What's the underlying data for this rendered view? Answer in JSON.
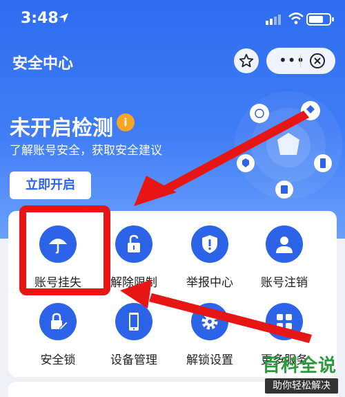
{
  "status_bar": {
    "time": "3:48"
  },
  "nav": {
    "title": "安全中心"
  },
  "detection": {
    "title": "未开启检测",
    "info_badge": "i",
    "subtitle": "了解账号安全，获取安全建议",
    "button_label": "立即开启"
  },
  "grid": [
    {
      "label": "账号挂失",
      "icon": "umbrella-icon"
    },
    {
      "label": "解除限制",
      "icon": "unlock-icon"
    },
    {
      "label": "举报中心",
      "icon": "shield-alert-icon"
    },
    {
      "label": "账号注销",
      "icon": "person-icon"
    },
    {
      "label": "安全锁",
      "icon": "lock-edit-icon"
    },
    {
      "label": "设备管理",
      "icon": "phone-icon"
    },
    {
      "label": "解锁设置",
      "icon": "gear-icon"
    },
    {
      "label": "更多服务",
      "icon": "grid-icon"
    }
  ],
  "watermark": {
    "main": "百科全说",
    "sub": "助你轻松解决"
  },
  "colors": {
    "primary": "#2d63e8",
    "annotation": "#e81515",
    "watermark": "#2a9a3b"
  }
}
